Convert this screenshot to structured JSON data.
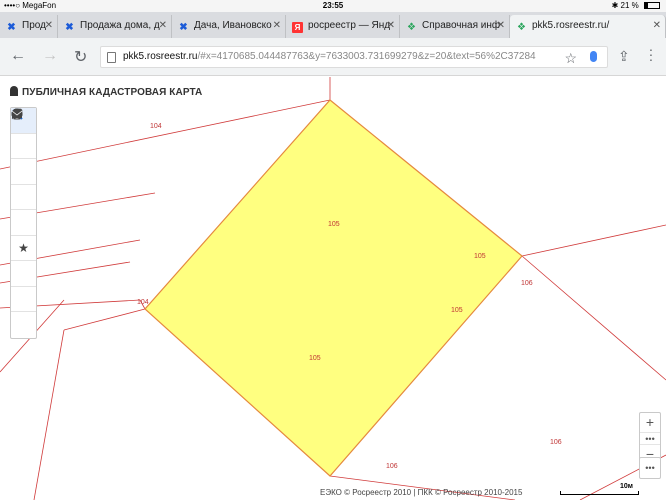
{
  "status_bar": {
    "carrier": "••••○ MegaFon",
    "wifi_icon": "wifi-icon",
    "time": "23:55",
    "bluetooth": "✱",
    "battery_text": "21 %"
  },
  "tabs": [
    {
      "title": "Прод",
      "favicon": "blue-cross-icon"
    },
    {
      "title": "Продажа дома, д",
      "favicon": "blue-cross-icon"
    },
    {
      "title": "Дача, Ивановско",
      "favicon": "blue-cross-icon"
    },
    {
      "title": "росреестр — Янд",
      "favicon": "yandex-icon"
    },
    {
      "title": "Справочная инф",
      "favicon": "sprav-icon"
    },
    {
      "title": "pkk5.rosreestr.ru/",
      "favicon": "sprav-icon"
    }
  ],
  "address_bar": {
    "host": "pkk5.rosreestr.ru",
    "path": "/#x=4170685.044487763&y=7633003.731699279&z=20&text=56%2C37284"
  },
  "brand": {
    "title": "ПУБЛИЧНАЯ КАДАСТРОВАЯ КАРТА"
  },
  "tools": [
    {
      "name": "search-icon",
      "glyph": "⚲",
      "active": true
    },
    {
      "name": "info-icon",
      "glyph": "ⓘ",
      "active": false
    },
    {
      "name": "layers-icon",
      "glyph": "◈",
      "active": false
    },
    {
      "name": "pencil-icon",
      "glyph": "✎",
      "active": false
    },
    {
      "name": "measure-icon",
      "glyph": "✐",
      "active": false
    },
    {
      "name": "star-icon",
      "glyph": "★",
      "active": false
    },
    {
      "name": "print-icon",
      "glyph": "⎙",
      "active": false
    },
    {
      "name": "help-icon",
      "glyph": "?",
      "active": false
    },
    {
      "name": "mail-icon",
      "glyph": "✉",
      "active": false
    }
  ],
  "parcel_labels": {
    "l104_top": "104",
    "l104_left": "104",
    "l105_top": "105",
    "l105_right": "105",
    "l105_mid": "105",
    "l105_bottom": "105",
    "l106_right": "106",
    "l106_lower_right": "106",
    "l106_bottom": "106"
  },
  "zoom": {
    "plus": "+",
    "dots": "•••",
    "minus": "−",
    "more": "•••"
  },
  "footer": {
    "copyright": "ЕЭКО © Росреестр 2010 | ПКК © Росреестр 2010-2015",
    "scale": "10м"
  },
  "colors": {
    "parcel_fill": "#ffff80",
    "parcel_border": "#e5893e",
    "boundary": "#d03a3a"
  }
}
